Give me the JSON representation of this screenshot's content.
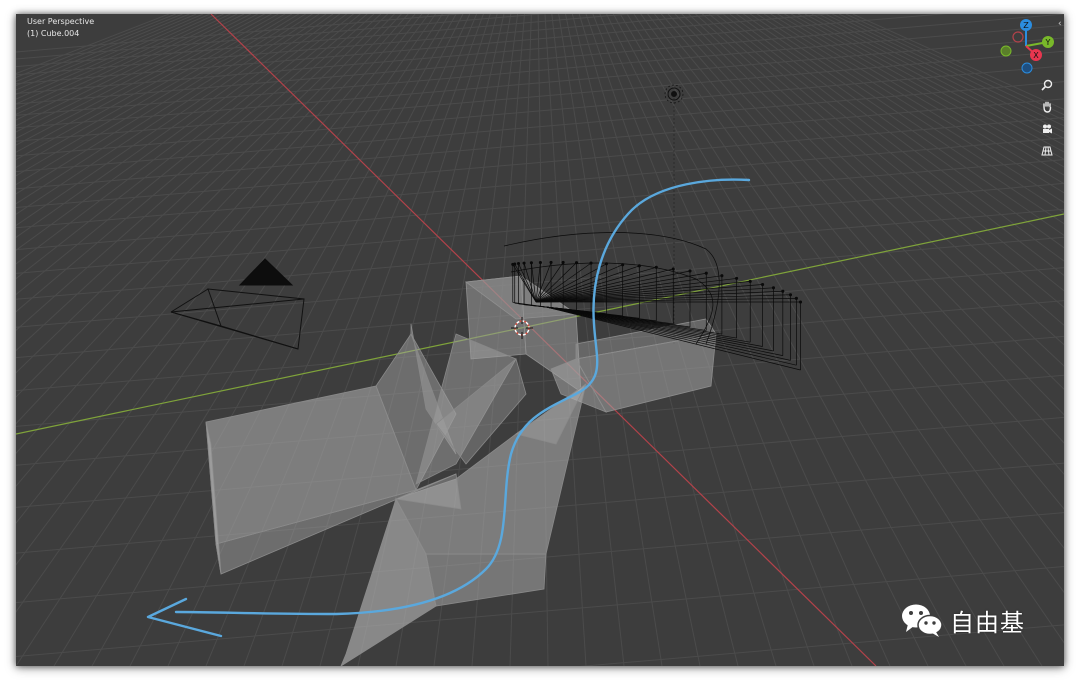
{
  "viewport": {
    "mode_label": "User Perspective",
    "object_label": "(1) Cube.004"
  },
  "gizmo": {
    "axis_z": "Z",
    "axis_y": "Y",
    "axis_x": "X",
    "color_x": "#e8364f",
    "color_y": "#79b92a",
    "color_z": "#2b8ddf"
  },
  "nav_tools": [
    {
      "name": "zoom",
      "icon": "zoom-icon"
    },
    {
      "name": "pan",
      "icon": "hand-icon"
    },
    {
      "name": "camera",
      "icon": "camera-icon"
    },
    {
      "name": "perspective-toggle",
      "icon": "grid-icon"
    }
  ],
  "colors": {
    "background": "#3d3d3d",
    "grid": "#4a4a4a",
    "x_axis": "#b3424a",
    "y_axis": "#7fa33a",
    "annotation_stroke": "#5aa8dd",
    "mesh": "#8a8a8a"
  },
  "watermark": {
    "text": "自由基",
    "icon": "wechat-icon"
  }
}
